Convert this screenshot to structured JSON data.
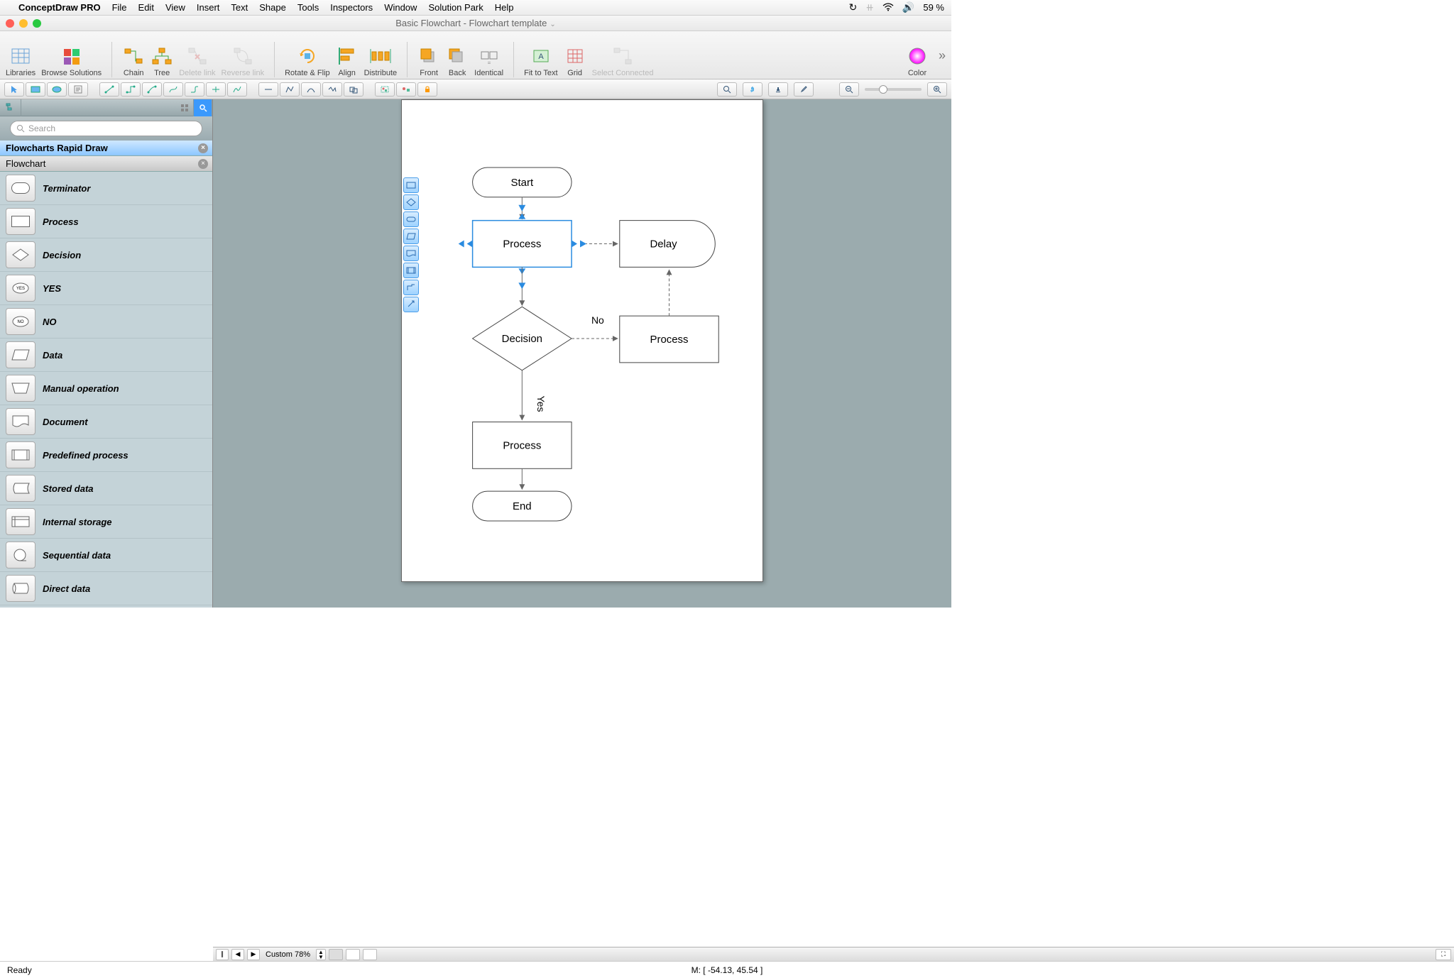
{
  "menubar": {
    "app": "ConceptDraw PRO",
    "items": [
      "File",
      "Edit",
      "View",
      "Insert",
      "Text",
      "Shape",
      "Tools",
      "Inspectors",
      "Window",
      "Solution Park",
      "Help"
    ],
    "battery": "59 %"
  },
  "titlebar": {
    "title": "Basic Flowchart - Flowchart template"
  },
  "toolbar": {
    "libraries": "Libraries",
    "browse": "Browse Solutions",
    "chain": "Chain",
    "tree": "Tree",
    "deletelink": "Delete link",
    "reverselink": "Reverse link",
    "rotateflip": "Rotate & Flip",
    "align": "Align",
    "distribute": "Distribute",
    "front": "Front",
    "back": "Back",
    "identical": "Identical",
    "fittotext": "Fit to Text",
    "grid": "Grid",
    "selectconnected": "Select Connected",
    "color": "Color"
  },
  "sidebar": {
    "search_placeholder": "Search",
    "lib_active": "Flowcharts Rapid Draw",
    "lib_inactive": "Flowchart",
    "shapes": [
      {
        "name": "Terminator"
      },
      {
        "name": "Process"
      },
      {
        "name": "Decision"
      },
      {
        "name": "YES"
      },
      {
        "name": "NO"
      },
      {
        "name": "Data"
      },
      {
        "name": "Manual operation"
      },
      {
        "name": "Document"
      },
      {
        "name": "Predefined process"
      },
      {
        "name": "Stored data"
      },
      {
        "name": "Internal storage"
      },
      {
        "name": "Sequential data"
      },
      {
        "name": "Direct data"
      }
    ]
  },
  "flowchart": {
    "start": "Start",
    "process1": "Process",
    "delay": "Delay",
    "decision": "Decision",
    "no": "No",
    "yes": "Yes",
    "process2": "Process",
    "process3": "Process",
    "end": "End"
  },
  "bottomstrip": {
    "zoom": "Custom 78%"
  },
  "statusbar": {
    "ready": "Ready",
    "coords": "M: [ -54.13, 45.54 ]"
  }
}
